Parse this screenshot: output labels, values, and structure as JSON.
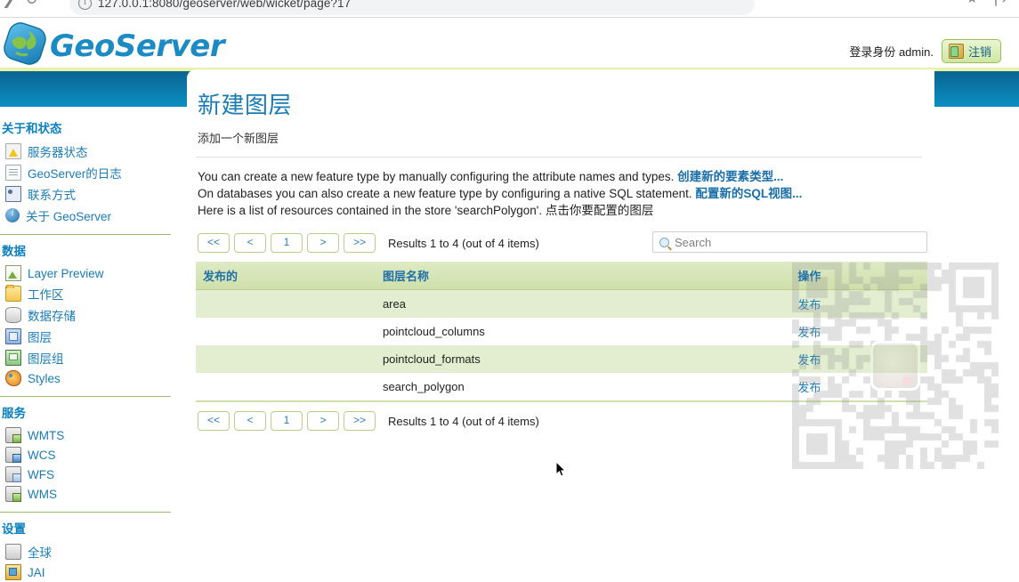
{
  "browser": {
    "url": "127.0.0.1:8080/geoserver/web/wicket/page?17",
    "back_icon": "back-arrow-icon",
    "forward_icon": "forward-arrow-icon",
    "reload_icon": "reload-icon",
    "info_icon": "site-info-icon",
    "star_icon": "bookmark-icon",
    "share_icon": "share-icon"
  },
  "header": {
    "brand": "GeoServer",
    "logo_icon": "geoserver-globe-logo",
    "login_text": "登录身份 admin.",
    "logout_label": "注销",
    "logout_icon": "logout-door-icon"
  },
  "sidebar": {
    "sections": [
      {
        "title": "关于和状态",
        "items": [
          {
            "label": "服务器状态",
            "icon": "server-status-icon",
            "icon_class": "ico-status"
          },
          {
            "label": "GeoServer的日志",
            "icon": "log-document-icon",
            "icon_class": "ico-doc"
          },
          {
            "label": "联系方式",
            "icon": "contact-card-icon",
            "icon_class": "ico-contact"
          },
          {
            "label": "关于 GeoServer",
            "icon": "about-info-icon",
            "icon_class": "ico-about"
          }
        ]
      },
      {
        "title": "数据",
        "items": [
          {
            "label": "Layer Preview",
            "icon": "layer-preview-icon",
            "icon_class": "ico-preview"
          },
          {
            "label": "工作区",
            "icon": "workspace-folder-icon",
            "icon_class": "ico-folder"
          },
          {
            "label": "数据存储",
            "icon": "data-store-icon",
            "icon_class": "ico-store"
          },
          {
            "label": "图层",
            "icon": "layer-icon",
            "icon_class": "ico-layer"
          },
          {
            "label": "图层组",
            "icon": "layer-group-icon",
            "icon_class": "ico-layergroup"
          },
          {
            "label": "Styles",
            "icon": "styles-palette-icon",
            "icon_class": "ico-styles"
          }
        ]
      },
      {
        "title": "服务",
        "items": [
          {
            "label": "WMTS",
            "icon": "wmts-service-icon",
            "icon_class": "ico-srv"
          },
          {
            "label": "WCS",
            "icon": "wcs-service-icon",
            "icon_class": "ico-srv ico-srv-b"
          },
          {
            "label": "WFS",
            "icon": "wfs-service-icon",
            "icon_class": "ico-srv ico-srv-c"
          },
          {
            "label": "WMS",
            "icon": "wms-service-icon",
            "icon_class": "ico-srv"
          }
        ]
      },
      {
        "title": "设置",
        "items": [
          {
            "label": "全球",
            "icon": "global-settings-icon",
            "icon_class": "ico-global"
          },
          {
            "label": "JAI",
            "icon": "jai-settings-icon",
            "icon_class": "ico-jai"
          }
        ]
      }
    ]
  },
  "main": {
    "title": "新建图层",
    "subtitle": "添加一个新图层",
    "desc_line1_text": "You can create a new feature type by manually configuring the attribute names and types. ",
    "desc_line1_link": "创建新的要素类型...",
    "desc_line2_text": "On databases you can also create a new feature type by configuring a native SQL statement. ",
    "desc_line2_link": "配置新的SQL视图...",
    "desc_line3_text": "Here is a list of resources contained in the store 'searchPolygon'. ",
    "desc_line3_link": "点击你要配置的图层"
  },
  "pager": {
    "first": "<<",
    "prev": "<",
    "page": "1",
    "next": ">",
    "last": ">>",
    "results": "Results 1 to 4 (out of 4 items)"
  },
  "search": {
    "placeholder": "Search",
    "value": "",
    "icon": "search-magnifier-icon"
  },
  "table": {
    "columns": [
      "发布的",
      "图层名称",
      "操作"
    ],
    "rows": [
      {
        "published": "",
        "name": "area",
        "action": "发布"
      },
      {
        "published": "",
        "name": "pointcloud_columns",
        "action": "发布"
      },
      {
        "published": "",
        "name": "pointcloud_formats",
        "action": "发布"
      },
      {
        "published": "",
        "name": "search_polygon",
        "action": "发布"
      }
    ]
  },
  "overlay": {
    "qr_name": "qr-code-watermark",
    "avatar_name": "qr-center-avatar"
  },
  "colors": {
    "brand_blue": "#1c8bc4",
    "banner_top": "#0a6490",
    "banner_bottom": "#0b8fc4",
    "accent_green": "#cfe0ab",
    "row_alt": "#e3eed0",
    "link_blue": "#1a7cb5"
  }
}
